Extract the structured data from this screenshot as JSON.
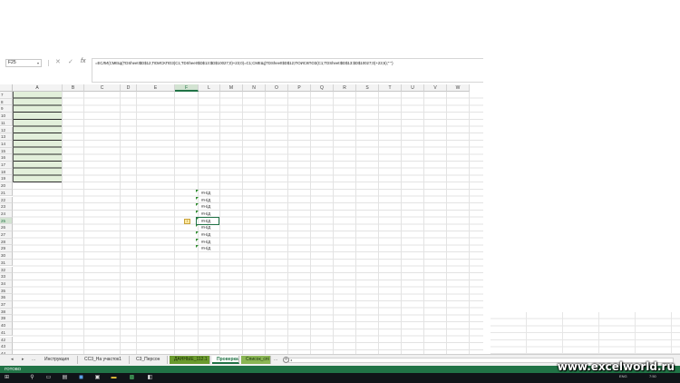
{
  "formula_bar": {
    "name_box": "F25",
    "cancel_glyph": "✕",
    "enter_glyph": "✓",
    "fx_label": "fx",
    "formula": "=ЕСЛИ(СМЕЩ(TDSheet!$D$12;ПОИСКПОЗ(C1;TDSheet!$D$13:$D$10027;0)+23;0)=C1;СМЕЩ(TDSheet!$D$12;ПОИСКПОЗ(C1;TDSheet!$D$13:$D$10027;0)+23;6);\" \")"
  },
  "columns": [
    "A",
    "B",
    "C",
    "D",
    "E",
    "F",
    "L",
    "M",
    "N",
    "O",
    "P",
    "Q",
    "R",
    "S",
    "T",
    "U",
    "V",
    "W"
  ],
  "selected_column": "F",
  "rows": [
    "7",
    "8",
    "9",
    "10",
    "11",
    "12",
    "13",
    "14",
    "15",
    "16",
    "17",
    "18",
    "19",
    "20",
    "21",
    "22",
    "23",
    "24",
    "25",
    "26",
    "27",
    "28",
    "29",
    "30",
    "31",
    "32",
    "33",
    "34",
    "35",
    "36",
    "37",
    "38",
    "39",
    "40",
    "41",
    "42",
    "43",
    "44",
    "45"
  ],
  "selected_row": "25",
  "na_cells": [
    "#Н/Д",
    "#Н/Д",
    "#Н/Д",
    "#Н/Д",
    "#Н/Д",
    "#Н/Д",
    "#Н/Д",
    "#Н/Д",
    "#Н/Д"
  ],
  "error_indicator_glyph": "!",
  "sheet_tabs": {
    "nav_prev": "◂",
    "nav_next": "▸",
    "ellipsis": "...",
    "tabs": [
      {
        "label": "Инструкция",
        "style": "plain"
      },
      {
        "label": "СС3_На участок1",
        "style": "plain"
      },
      {
        "label": "С3_Персон",
        "style": "plain"
      },
      {
        "label": "ДАННЫЕ_112.1",
        "style": "green"
      },
      {
        "label": "Проверка",
        "style": "active"
      },
      {
        "label": "Список_спі",
        "style": "lightgreen"
      }
    ],
    "overflow": "...",
    "add_glyph": "+"
  },
  "status_bar": {
    "mode": "ГОТОВО"
  },
  "watermark": "www.excelworld.ru",
  "taskbar": {
    "language": "ENG",
    "time": "7:50",
    "date": "..."
  },
  "colors": {
    "excel_green": "#217346",
    "input_fill": "#e2efda",
    "tab_green": "#6a9a2e"
  }
}
